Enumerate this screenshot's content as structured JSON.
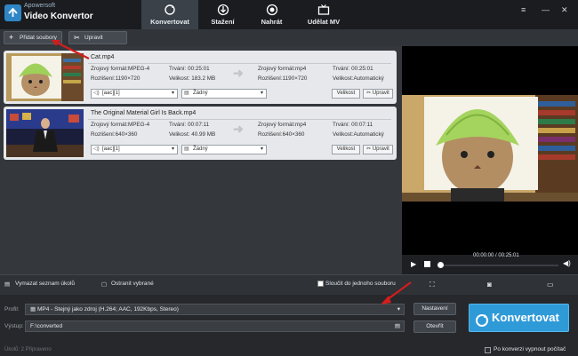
{
  "app": {
    "brand_top": "Apowersoft",
    "brand_main": "Video Konvertor"
  },
  "nav_tabs": [
    {
      "label": "Konvertovat",
      "icon": "refresh-icon"
    },
    {
      "label": "Stažení",
      "icon": "download-icon"
    },
    {
      "label": "Nahrát",
      "icon": "record-icon"
    },
    {
      "label": "Udělat MV",
      "icon": "tv-icon"
    }
  ],
  "toolbar": {
    "add_files": "Přidat soubory",
    "edit": "Upravit"
  },
  "files": [
    {
      "name": "Cat.mp4",
      "src_format": "Zrojový formát:MPEG-4",
      "src_duration": "Trvání: 00:25:01",
      "dst_format": "Zrojový formát:mp4",
      "dst_duration": "Trvání: 00:25:01",
      "src_resolution": "Rozlišení:1190×720",
      "src_size": "Velikost: 183.2 MB",
      "dst_resolution": "Rozlišení:1190×720",
      "dst_size": "Velikost:Automatický",
      "audio": "[aac][1]",
      "subtitle": "Žádný",
      "size_btn": "Velikost",
      "edit_btn": "Upravit"
    },
    {
      "name": "The Original Material Girl Is Back.mp4",
      "src_format": "Zrojový formát:MPEG-4",
      "src_duration": "Trvání: 00:07:11",
      "dst_format": "Zrojový formát:mp4",
      "dst_duration": "Trvání: 00:07:11",
      "src_resolution": "Rozlišení:640×360",
      "src_size": "Velikost: 40.99 MB",
      "dst_resolution": "Rozlišení:640×360",
      "dst_size": "Velikost:Automatický",
      "audio": "[aac][1]",
      "subtitle": "Žádný",
      "size_btn": "Velikost",
      "edit_btn": "Upravit"
    }
  ],
  "preview": {
    "time": "00:00:00 / 00:25:01"
  },
  "bottom": {
    "clear_list": "Vymazat seznam úkolů",
    "remove_selected": "Ostranit vybrané",
    "merge": "Sloučit do jednoho souboru",
    "profile_label": "Profil:",
    "profile_value": "MP4 - Stejný jako zdroj (H.264; AAC, 192Kbps, Stereo)",
    "output_label": "Výstup:",
    "output_value": "F:\\converted",
    "settings_btn": "Nastavení",
    "open_btn": "Otevřít",
    "convert_btn": "Konvertovat",
    "shutdown": "Po konverzi vypnout počítač",
    "status": "Úkolů: 2   Připraveno"
  },
  "colors": {
    "accent": "#2f9ad8",
    "annotation": "#d21d1d",
    "titlebar": "#1a1c1f"
  }
}
